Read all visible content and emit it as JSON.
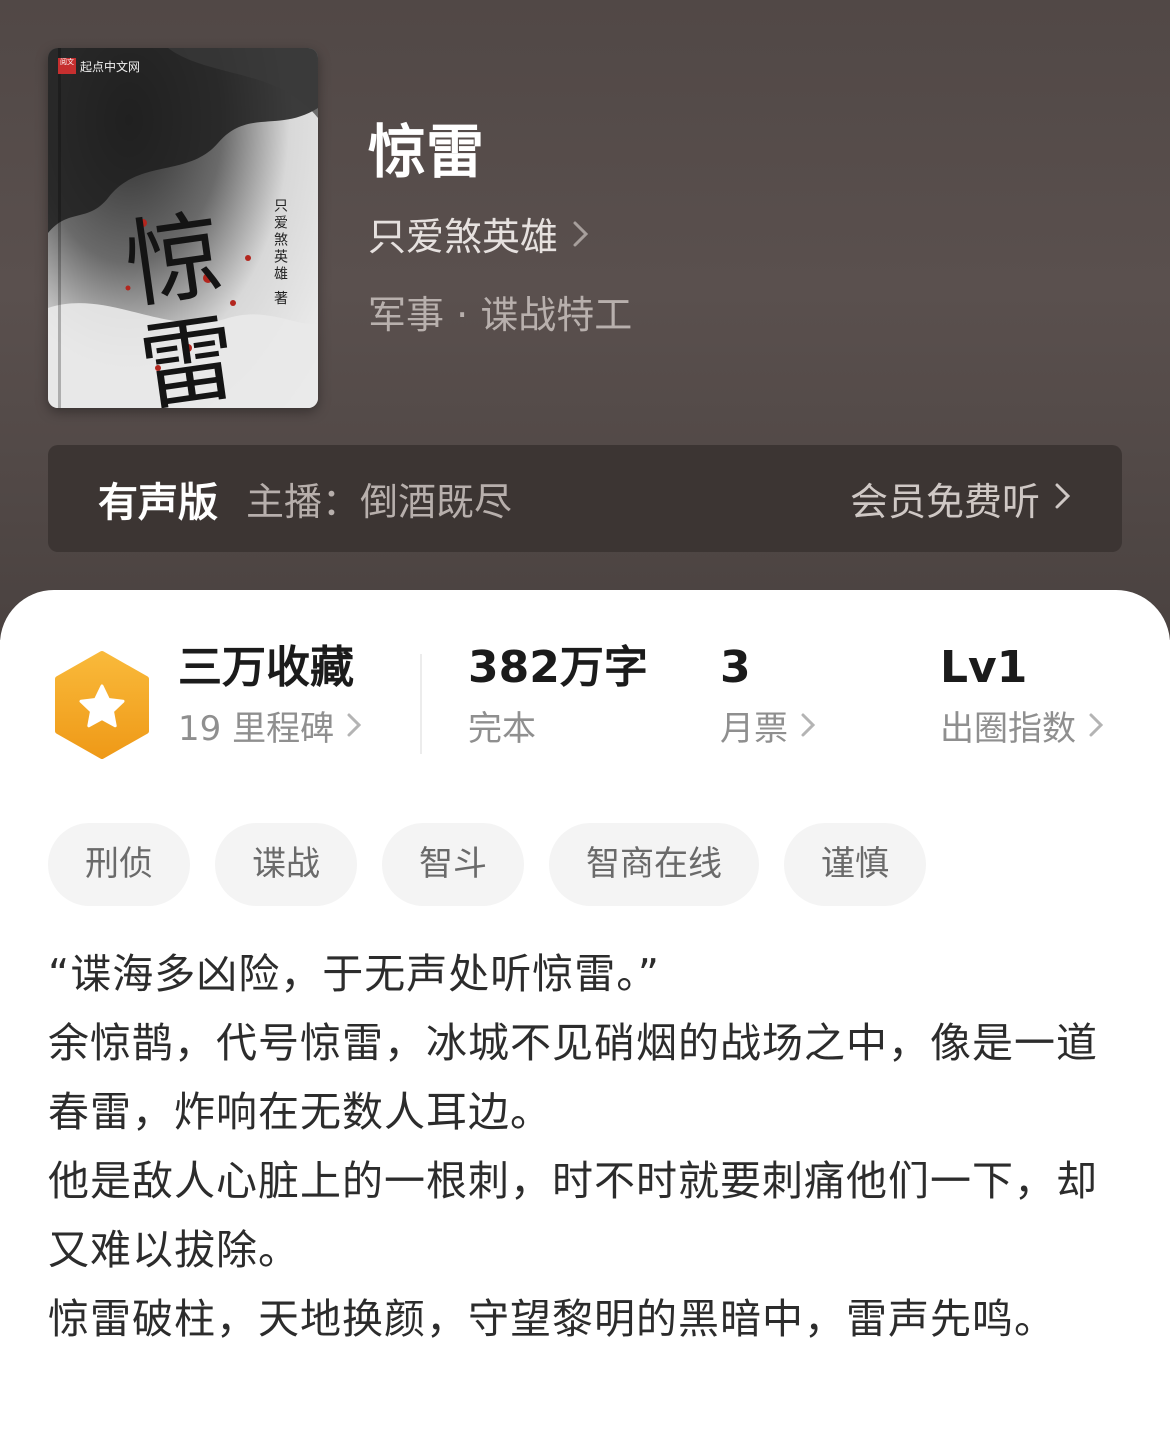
{
  "cover": {
    "brand": "起点中文网",
    "badge": "阅文",
    "title": "惊雷",
    "author_vertical": "只爱煞英雄 著"
  },
  "book": {
    "title": "惊雷",
    "author": "只爱煞英雄",
    "genre": "军事 · 谍战特工"
  },
  "audio": {
    "label": "有声版",
    "host": "主播：倒酒既尽",
    "action": "会员免费听"
  },
  "stats": {
    "collection": {
      "value": "三万收藏",
      "sub": "19 里程碑"
    },
    "words": {
      "value": "382万字",
      "sub": "完本"
    },
    "tickets": {
      "value": "3",
      "sub": "月票"
    },
    "index": {
      "value": "Lv1",
      "sub": "出圈指数"
    }
  },
  "tags": [
    "刑侦",
    "谍战",
    "智斗",
    "智商在线",
    "谨慎"
  ],
  "description": [
    "“谍海多凶险，于无声处听惊雷。”",
    "余惊鹊，代号惊雷，冰城不见硝烟的战场之中，像是一道春雷，炸响在无数人耳边。",
    "他是敌人心脏上的一根刺，时不时就要刺痛他们一下，却又难以拔除。",
    "惊雷破柱，天地换颜，守望黎明的黑暗中，雷声先鸣。"
  ],
  "icons": {
    "chevron": "chevron-right-icon",
    "milestone": "star-hexagon-icon"
  },
  "colors": {
    "header_bg": "#514846",
    "milestone_orange": "#f5a623"
  }
}
